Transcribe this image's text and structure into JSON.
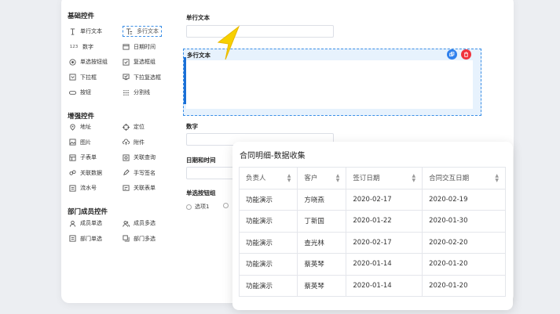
{
  "palette": {
    "basic": {
      "title": "基础控件",
      "items": [
        {
          "label": "单行文本",
          "icon": "text-cursor-icon"
        },
        {
          "label": "多行文本",
          "icon": "multiline-text-icon"
        },
        {
          "label": "数字",
          "icon": "number-icon",
          "glyph": "123"
        },
        {
          "label": "日期时间",
          "icon": "calendar-icon"
        },
        {
          "label": "单选按钮组",
          "icon": "radio-icon"
        },
        {
          "label": "复选框组",
          "icon": "checkbox-icon"
        },
        {
          "label": "下拉框",
          "icon": "dropdown-icon"
        },
        {
          "label": "下拉复选框",
          "icon": "dropdown-checkbox-icon"
        },
        {
          "label": "按钮",
          "icon": "button-icon"
        },
        {
          "label": "分割线",
          "icon": "divider-icon"
        }
      ]
    },
    "enhanced": {
      "title": "增强控件",
      "items": [
        {
          "label": "地址",
          "icon": "location-pin-icon"
        },
        {
          "label": "定位",
          "icon": "crosshair-icon"
        },
        {
          "label": "图片",
          "icon": "image-icon"
        },
        {
          "label": "附件",
          "icon": "cloud-upload-icon"
        },
        {
          "label": "子表单",
          "icon": "subform-icon"
        },
        {
          "label": "关联查询",
          "icon": "link-query-icon"
        },
        {
          "label": "关联数据",
          "icon": "link-data-icon"
        },
        {
          "label": "手写签名",
          "icon": "pen-icon"
        },
        {
          "label": "流水号",
          "icon": "serial-number-icon"
        },
        {
          "label": "关联表单",
          "icon": "link-form-icon"
        }
      ]
    },
    "department": {
      "title": "部门成员控件",
      "items": [
        {
          "label": "成员单选",
          "icon": "user-icon"
        },
        {
          "label": "成员多选",
          "icon": "users-icon"
        },
        {
          "label": "部门单选",
          "icon": "department-icon"
        },
        {
          "label": "部门多选",
          "icon": "departments-icon"
        }
      ]
    }
  },
  "form": {
    "single_line_label": "单行文本",
    "multi_line_label": "多行文本",
    "number_label": "数字",
    "datetime_label": "日期和时间",
    "radio_group_label": "单选按钮组",
    "radio_option_1": "选项1"
  },
  "table": {
    "title": "合同明细-数据收集",
    "columns": [
      "负责人",
      "客户",
      "签订日期",
      "合同交互日期"
    ],
    "rows": [
      [
        "功能演示",
        "方晓燕",
        "2020-02-17",
        "2020-02-19"
      ],
      [
        "功能演示",
        "丁新国",
        "2020-01-22",
        "2020-01-30"
      ],
      [
        "功能演示",
        "查光林",
        "2020-02-17",
        "2020-02-20"
      ],
      [
        "功能演示",
        "蔡英琴",
        "2020-01-14",
        "2020-01-20"
      ],
      [
        "功能演示",
        "蔡英琴",
        "2020-01-14",
        "2020-01-20"
      ]
    ]
  },
  "colors": {
    "accent": "#3a8ee6",
    "selected_bg": "#e7f2fd",
    "copy_button": "#2f80ed",
    "delete_button": "#f0323c",
    "cursor": "#f7d000"
  }
}
